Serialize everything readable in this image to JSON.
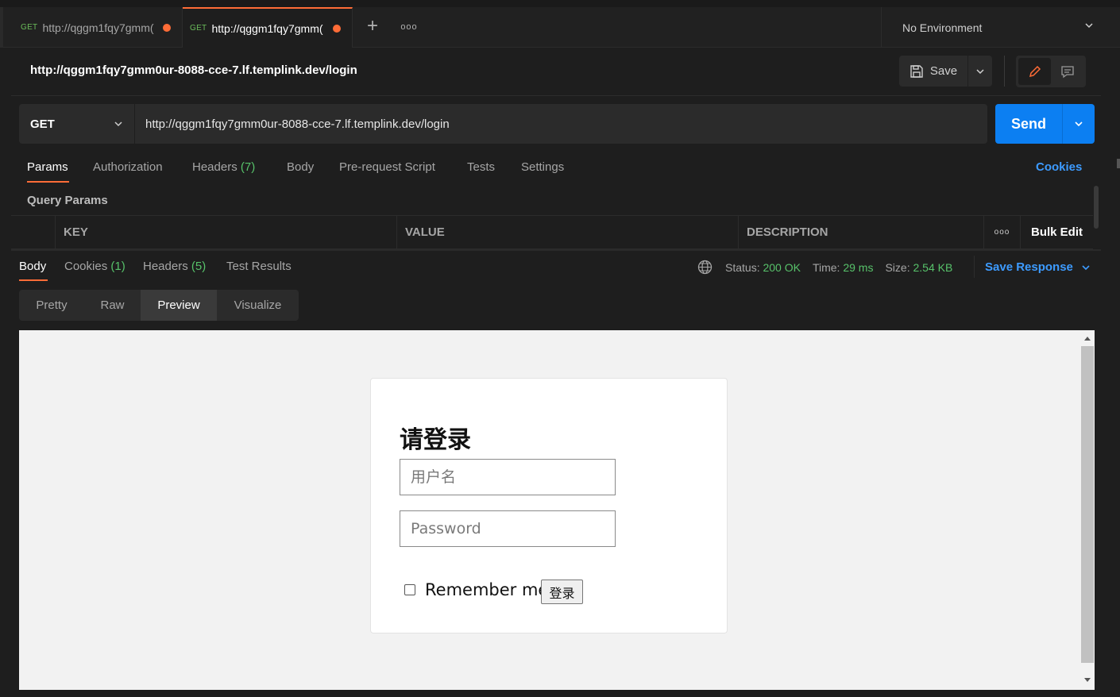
{
  "tabs": [
    {
      "method": "GET",
      "title": "http://qggm1fqy7gmm("
    },
    {
      "method": "GET",
      "title": "http://qggm1fqy7gmm("
    }
  ],
  "environment": {
    "label": "No Environment"
  },
  "request": {
    "title": "http://qggm1fqy7gmm0ur-8088-cce-7.lf.templink.dev/login",
    "save_label": "Save",
    "method": "GET",
    "url": "http://qggm1fqy7gmm0ur-8088-cce-7.lf.templink.dev/login",
    "send_label": "Send"
  },
  "request_tabs": {
    "params": "Params",
    "authorization": "Authorization",
    "headers": "Headers",
    "headers_count": "(7)",
    "body": "Body",
    "prerequest": "Pre-request Script",
    "tests": "Tests",
    "settings": "Settings",
    "cookies": "Cookies"
  },
  "query_params": {
    "label": "Query Params",
    "columns": [
      "KEY",
      "VALUE",
      "DESCRIPTION"
    ],
    "bulk_edit": "Bulk Edit"
  },
  "response_tabs": {
    "body": "Body",
    "cookies": "Cookies",
    "cookies_count": "(1)",
    "headers": "Headers",
    "headers_count": "(5)",
    "test_results": "Test Results"
  },
  "response_status": {
    "status_label": "Status:",
    "status_value": "200 OK",
    "time_label": "Time:",
    "time_value": "29 ms",
    "size_label": "Size:",
    "size_value": "2.54 KB",
    "save_response": "Save Response"
  },
  "view_modes": [
    "Pretty",
    "Raw",
    "Preview",
    "Visualize"
  ],
  "view_mode_selected": "Preview",
  "preview_page": {
    "heading": "请登录",
    "username_placeholder": "用户名",
    "password_placeholder": "Password",
    "remember_label": "Remember me",
    "submit_label": "登录"
  },
  "colors": {
    "accent": "#ff6c37",
    "send": "#0c7ff2",
    "link": "#3d9bff",
    "success": "#57c26a"
  }
}
